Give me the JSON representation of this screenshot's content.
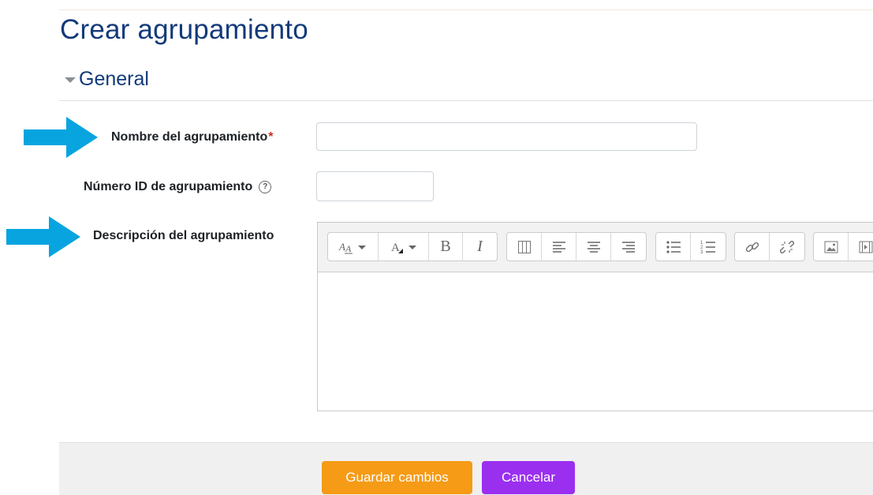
{
  "page": {
    "title": "Crear agrupamiento"
  },
  "section": {
    "title": "General"
  },
  "form": {
    "name_label": "Nombre del agrupamiento",
    "required_mark": "*",
    "name_value": "",
    "idnumber_label": "Número ID de agrupamiento",
    "help_icon_text": "?",
    "idnumber_value": "",
    "description_label": "Descripción del agrupamiento"
  },
  "editor": {
    "toolbar_groups": [
      [
        "font-style-icon",
        "font-color-icon",
        "bold-icon",
        "italic-icon"
      ],
      [
        "table-icon",
        "align-left-icon",
        "align-center-icon",
        "align-right-icon"
      ],
      [
        "unordered-list-icon",
        "ordered-list-icon"
      ],
      [
        "link-icon",
        "unlink-icon"
      ],
      [
        "image-icon",
        "media-icon"
      ]
    ],
    "content": ""
  },
  "buttons": {
    "save_label": "Guardar cambios",
    "cancel_label": "Cancelar"
  },
  "colors": {
    "title": "#123a7a",
    "arrow": "#08a4e0",
    "save": "#f59b16",
    "cancel": "#9b2ff0",
    "required": "#ca3120"
  }
}
